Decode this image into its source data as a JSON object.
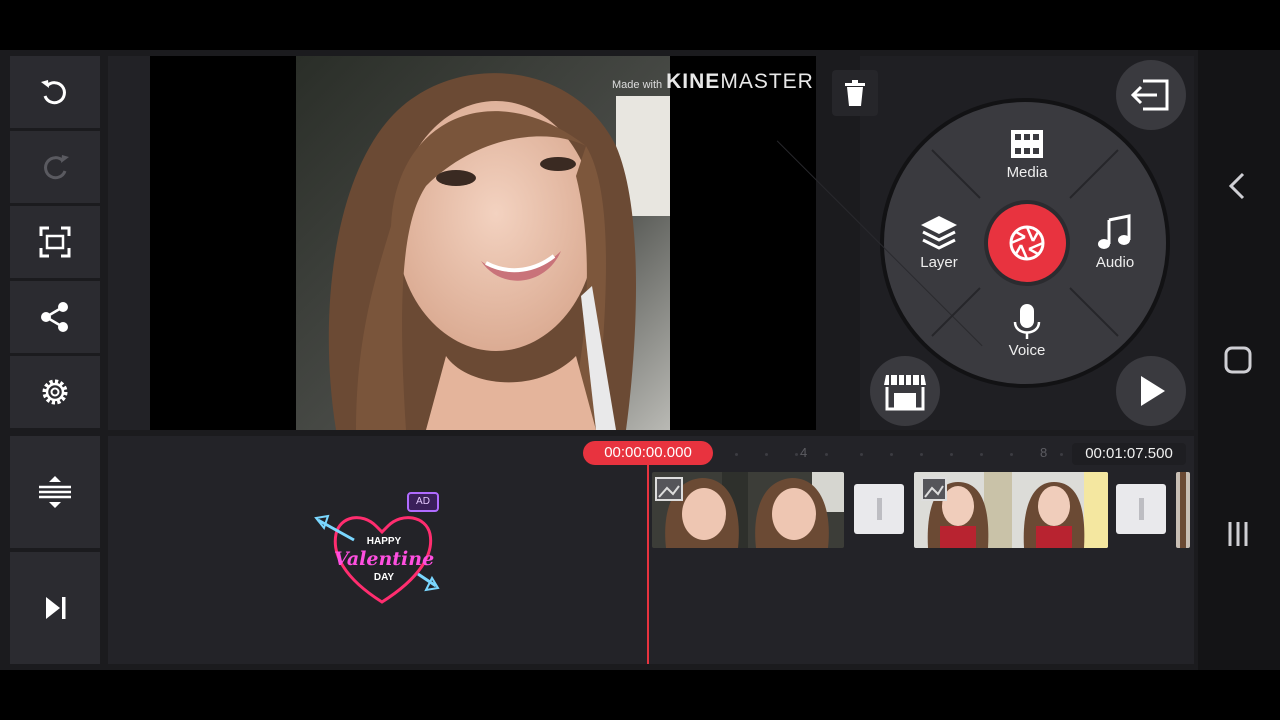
{
  "watermark": {
    "prefix": "Made with",
    "brand_bold": "KINE",
    "brand_thin": "MASTER"
  },
  "wheel": {
    "media_label": "Media",
    "layer_label": "Layer",
    "audio_label": "Audio",
    "voice_label": "Voice"
  },
  "timeline": {
    "current_time": "00:00:00.000",
    "total_time": "00:01:07.500",
    "tick_4": "4",
    "tick_8": "8"
  },
  "sticker": {
    "line1": "HAPPY",
    "line2": "Valentine",
    "line3": "DAY",
    "badge": "AD"
  },
  "colors": {
    "accent": "#e8333f",
    "panel": "#2b2b30",
    "background": "#1b1b1e"
  },
  "icons": {
    "left_toolbar": [
      "undo-icon",
      "redo-icon",
      "fullscreen-icon",
      "share-icon",
      "settings-icon",
      "expand-timeline-icon",
      "jump-to-end-icon"
    ],
    "right_panel": [
      "exit-icon",
      "delete-icon",
      "media-icon",
      "layer-icon",
      "audio-icon",
      "voice-icon",
      "record-icon",
      "store-icon",
      "play-icon"
    ],
    "navbar": [
      "back-icon",
      "home-icon",
      "recents-icon"
    ]
  }
}
